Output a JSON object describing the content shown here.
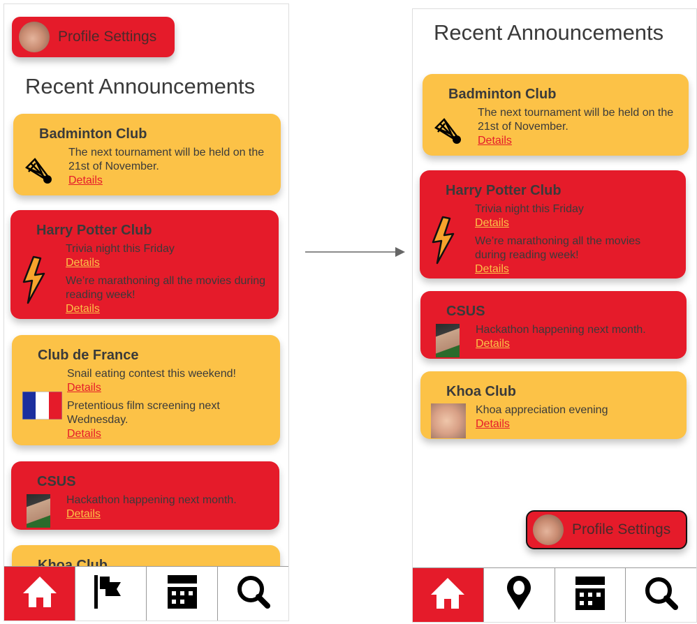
{
  "colors": {
    "red": "#e51b2a",
    "yellow": "#fcc247",
    "text": "#3a3a3a"
  },
  "profile_button": {
    "label": "Profile Settings",
    "avatar": "user-photo"
  },
  "title": "Recent Announcements",
  "left": {
    "cards": [
      {
        "club": "Badminton Club",
        "color": "yellow",
        "icon": "shuttlecock-icon",
        "items": [
          {
            "text": "The next tournament will be held on the 21st of November.",
            "link": "Details"
          }
        ]
      },
      {
        "club": "Harry Potter Club",
        "color": "red",
        "icon": "lightning-bolt-icon",
        "items": [
          {
            "text": "Trivia night this Friday",
            "link": "Details"
          },
          {
            "text": "We’re marathoning all the movies during reading week!",
            "link": "Details"
          }
        ]
      },
      {
        "club": "Club de France",
        "color": "yellow",
        "icon": "french-flag-icon",
        "items": [
          {
            "text": "Snail eating contest this weekend!",
            "link": "Details"
          },
          {
            "text": "Pretentious film screening next Wednesday.",
            "link": "Details"
          }
        ]
      },
      {
        "club": "CSUS",
        "color": "red",
        "icon": "member-photo",
        "items": [
          {
            "text": "Hackathon happening next month.",
            "link": "Details"
          }
        ]
      },
      {
        "club": "Khoa Club",
        "color": "yellow",
        "icon": "",
        "items": []
      }
    ],
    "tabs": [
      {
        "icon": "home-icon",
        "active": true
      },
      {
        "icon": "flag-icon"
      },
      {
        "icon": "calendar-icon"
      },
      {
        "icon": "search-icon"
      }
    ]
  },
  "right": {
    "cards": [
      {
        "club": "Badminton Club",
        "color": "yellow",
        "icon": "shuttlecock-icon",
        "items": [
          {
            "text": "The next tournament will be held on the 21st of November.",
            "link": "Details"
          }
        ]
      },
      {
        "club": "Harry Potter Club",
        "color": "red",
        "icon": "lightning-bolt-icon",
        "items": [
          {
            "text": "Trivia night this Friday",
            "link": "Details"
          },
          {
            "text": "We’re marathoning all the movies during reading week!",
            "link": "Details"
          }
        ]
      },
      {
        "club": "CSUS",
        "color": "red",
        "icon": "member-photo",
        "items": [
          {
            "text": "Hackathon happening next month.",
            "link": "Details"
          }
        ]
      },
      {
        "club": "Khoa Club",
        "color": "yellow",
        "icon": "khoa-photo",
        "items": [
          {
            "text": "Khoa appreciation evening",
            "link": "Details"
          }
        ]
      }
    ],
    "tabs": [
      {
        "icon": "home-icon",
        "active": true
      },
      {
        "icon": "map-pin-icon"
      },
      {
        "icon": "calendar-icon"
      },
      {
        "icon": "search-icon"
      }
    ]
  }
}
